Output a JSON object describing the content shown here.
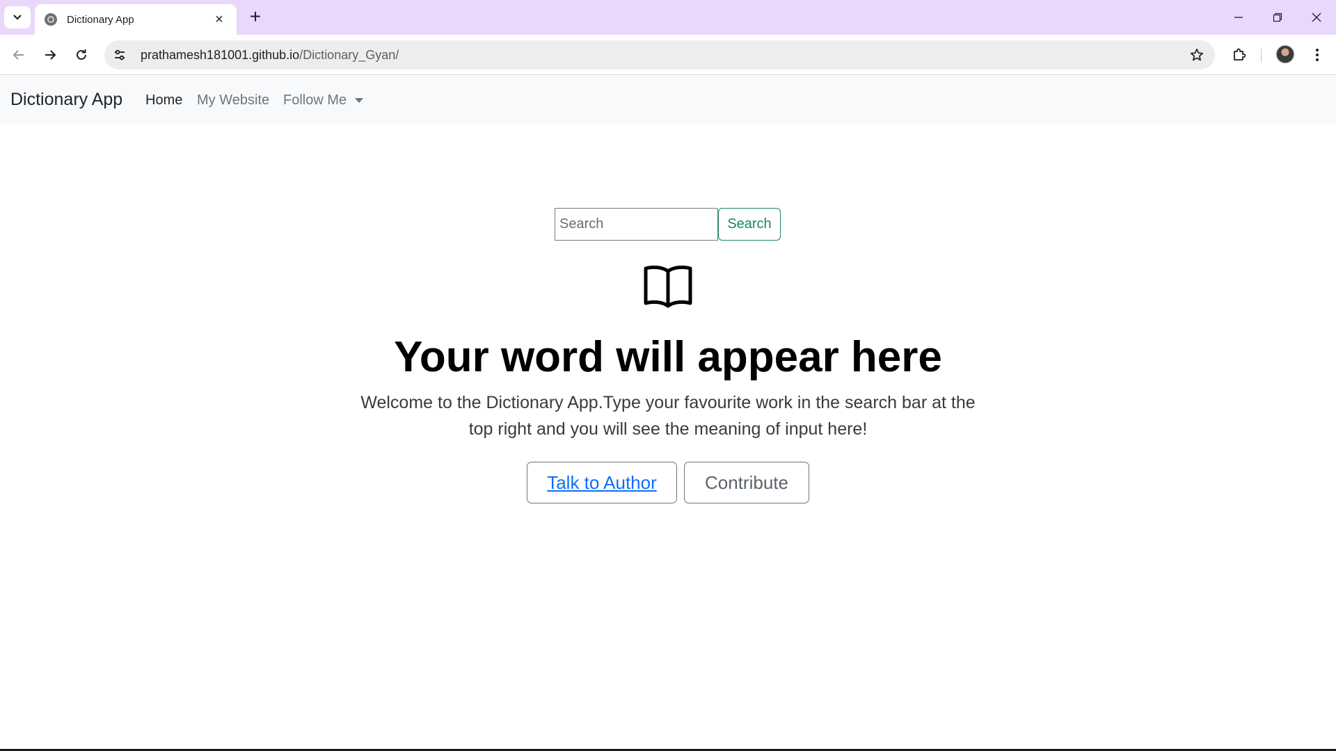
{
  "browser": {
    "tab_title": "Dictionary App",
    "tab_close": "×",
    "new_tab": "+",
    "url_host": "prathamesh181001.github.io",
    "url_path": "/Dictionary_Gyan/",
    "icons": [
      "tab-search-icon",
      "globe-icon",
      "back-arrow-icon",
      "forward-arrow-icon",
      "reload-icon",
      "site-info-icon",
      "star-icon",
      "extensions-icon",
      "profile-avatar",
      "kebab-menu-icon",
      "minimize-icon",
      "restore-icon",
      "close-window-icon"
    ]
  },
  "navbar": {
    "brand": "Dictionary App",
    "links": {
      "home": "Home",
      "website": "My Website",
      "follow": "Follow Me"
    }
  },
  "search": {
    "placeholder": "Search",
    "button_label": "Search"
  },
  "main": {
    "headline": "Your word will appear here",
    "lead": "Welcome to the Dictionary App.Type your favourite work in the search bar at the top right and you will see the meaning of input here!",
    "author_button": "Talk to Author",
    "contribute_button": "Contribute"
  },
  "colors": {
    "tabstrip": "#e9d8fb",
    "navbar_bg": "#f8f9fa",
    "success": "#198754",
    "link": "#0d6efd",
    "secondary": "#6c757d"
  }
}
